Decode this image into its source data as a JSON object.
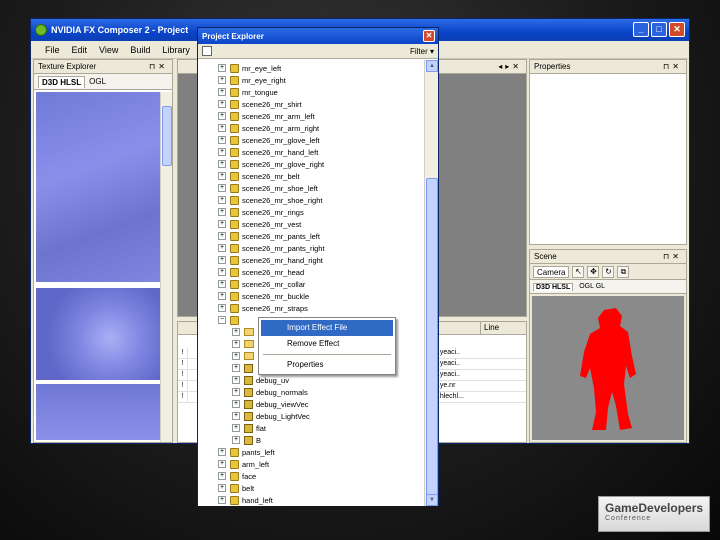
{
  "main_window": {
    "title": "NVIDIA FX Composer 2 - Project",
    "controls": [
      "_",
      "□",
      "✕"
    ]
  },
  "menu": [
    "File",
    "Edit",
    "View",
    "Build",
    "Library"
  ],
  "texture_explorer": {
    "title": "Texture Explorer",
    "tabs": [
      "D3D HLSL",
      "OGL"
    ]
  },
  "properties": {
    "title": "Properties"
  },
  "scene": {
    "title": "Scene",
    "camera_label": "Camera",
    "tabs": [
      "D3D HLSL",
      "OGL GL"
    ]
  },
  "output": {
    "col_line": "Line",
    "rows": [
      {
        "bang": "!",
        "msg": "...yeaci.."
      },
      {
        "bang": "!",
        "msg": "...yeaci.."
      },
      {
        "bang": "!",
        "msg": "...yeaci.."
      },
      {
        "bang": "!",
        "msg": "...ye.nr"
      },
      {
        "bang": "!",
        "msg": "...hlechl..."
      }
    ]
  },
  "project_explorer": {
    "title": "Project Explorer",
    "filter_label": "Filter",
    "items": [
      {
        "label": "mr_eye_left",
        "kind": "fx",
        "expander": "+"
      },
      {
        "label": "mr_eye_right",
        "kind": "fx",
        "expander": "+"
      },
      {
        "label": "mr_tongue",
        "kind": "fx",
        "expander": "+"
      },
      {
        "label": "scene26_mr_shirt",
        "kind": "fx",
        "expander": "+"
      },
      {
        "label": "scene26_mr_arm_left",
        "kind": "fx",
        "expander": "+"
      },
      {
        "label": "scene26_mr_arm_right",
        "kind": "fx",
        "expander": "+"
      },
      {
        "label": "scene26_mr_glove_left",
        "kind": "fx",
        "expander": "+"
      },
      {
        "label": "scene26_mr_hand_left",
        "kind": "fx",
        "expander": "+"
      },
      {
        "label": "scene26_mr_glove_right",
        "kind": "fx",
        "expander": "+"
      },
      {
        "label": "scene26_mr_belt",
        "kind": "fx",
        "expander": "+"
      },
      {
        "label": "scene26_mr_shoe_left",
        "kind": "fx",
        "expander": "+"
      },
      {
        "label": "scene26_mr_shoe_right",
        "kind": "fx",
        "expander": "+"
      },
      {
        "label": "scene26_mr_rings",
        "kind": "fx",
        "expander": "+"
      },
      {
        "label": "scene26_mr_vest",
        "kind": "fx",
        "expander": "+"
      },
      {
        "label": "scene26_mr_pants_left",
        "kind": "fx",
        "expander": "+"
      },
      {
        "label": "scene26_mr_pants_right",
        "kind": "fx",
        "expander": "+"
      },
      {
        "label": "scene26_mr_hand_right",
        "kind": "fx",
        "expander": "+"
      },
      {
        "label": "scene26_mr_head",
        "kind": "fx",
        "expander": "+"
      },
      {
        "label": "scene26_mr_collar",
        "kind": "fx",
        "expander": "+"
      },
      {
        "label": "scene26_mr_buckle",
        "kind": "fx",
        "expander": "+"
      },
      {
        "label": "scene26_mr_straps",
        "kind": "fx",
        "expander": "+"
      },
      {
        "label": "",
        "kind": "fx",
        "expander": "−",
        "selected": true
      },
      {
        "label": "",
        "kind": "folder",
        "expander": "+"
      },
      {
        "label": "",
        "kind": "folder",
        "expander": "+"
      },
      {
        "label": "",
        "kind": "folder",
        "expander": "+"
      },
      {
        "label": "",
        "kind": "cfx",
        "expander": "+"
      },
      {
        "label": "debug_uv",
        "kind": "cfx",
        "expander": "+"
      },
      {
        "label": "debug_normals",
        "kind": "cfx",
        "expander": "+"
      },
      {
        "label": "debug_viewVec",
        "kind": "cfx",
        "expander": "+"
      },
      {
        "label": "debug_LightVec",
        "kind": "cfx",
        "expander": "+"
      },
      {
        "label": "flat",
        "kind": "cfx",
        "expander": "+"
      },
      {
        "label": "B",
        "kind": "cfx",
        "expander": "+"
      },
      {
        "label": "pants_left",
        "kind": "fx",
        "expander": "+"
      },
      {
        "label": "arm_left",
        "kind": "fx",
        "expander": "+"
      },
      {
        "label": "face",
        "kind": "fx",
        "expander": "+"
      },
      {
        "label": "belt",
        "kind": "fx",
        "expander": "+"
      },
      {
        "label": "hand_left",
        "kind": "fx",
        "expander": "+"
      }
    ]
  },
  "context_menu": {
    "items": [
      "Import Effect File",
      "Remove Effect",
      "Properties"
    ]
  },
  "logo": {
    "line1": "GameDevelopers",
    "line2": "Conference"
  }
}
